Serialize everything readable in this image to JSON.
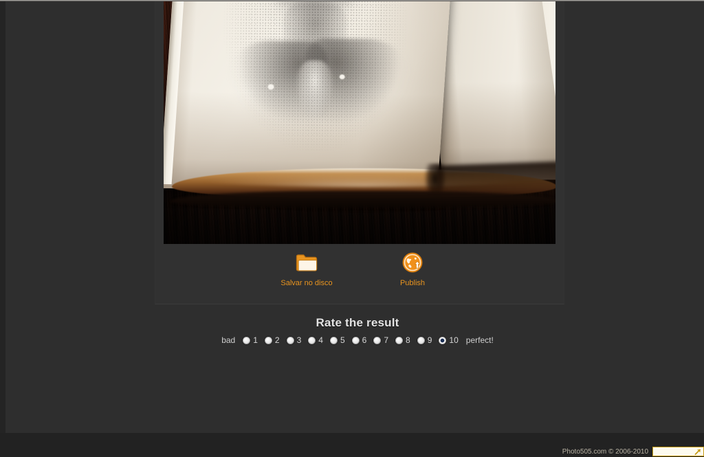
{
  "app": {
    "background_color": "#2e2e2e",
    "panel_color": "#313131",
    "accent_color": "#e8941f"
  },
  "result": {
    "photo": {
      "alt": "Pencil sketch portrait of a smiling man drawn on an open sketchbook page held by a hand on a dark wooden table",
      "effect_style": "pencil-sketch-in-notebook"
    },
    "actions": [
      {
        "id": "save-to-disk",
        "label": "Salvar no disco",
        "icon": "folder-icon"
      },
      {
        "id": "publish",
        "label": "Publish",
        "icon": "globe-upload-icon"
      }
    ]
  },
  "rating": {
    "title": "Rate the result",
    "low_label": "bad",
    "high_label": "perfect!",
    "selected": "10",
    "options": [
      "1",
      "2",
      "3",
      "4",
      "5",
      "6",
      "7",
      "8",
      "9",
      "10"
    ],
    "selected_color": "#1b2f55"
  },
  "footer": {
    "copyright": "Photo505.com © 2006-2010",
    "widget_icon": "arrow-up-right-icon",
    "widget_border_color": "#c79c16"
  }
}
